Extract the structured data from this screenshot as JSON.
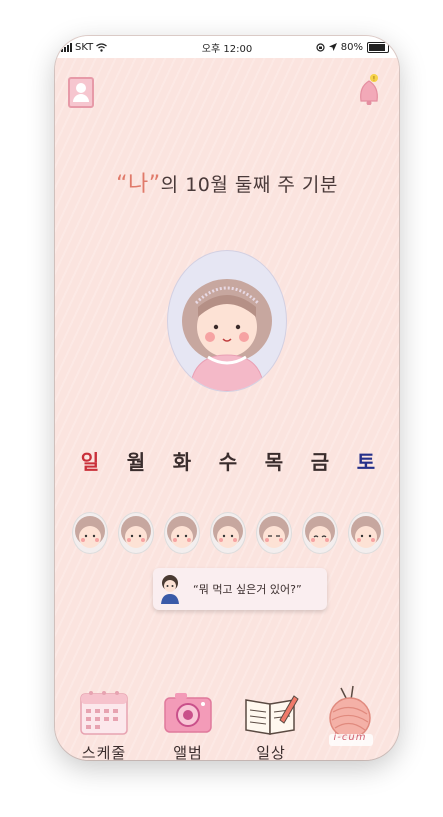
{
  "status_bar": {
    "carrier": "SKT",
    "time": "오후 12:00",
    "battery": "80%"
  },
  "header": {
    "title_prefix": "“나”",
    "title_suffix": "의 10월 둘째 주 기분"
  },
  "weekdays": [
    "일",
    "월",
    "화",
    "수",
    "목",
    "금",
    "토"
  ],
  "chat": {
    "text": "“뭐 먹고 싶은거 있어?”"
  },
  "menu": {
    "schedule": "스케줄",
    "album": "앨범",
    "daily": "일상",
    "yarn_logo": "i-cum"
  },
  "colors": {
    "background": "#fbe4df",
    "accent": "#e07a6a",
    "sunday": "#c9303a",
    "saturday": "#25308a"
  }
}
